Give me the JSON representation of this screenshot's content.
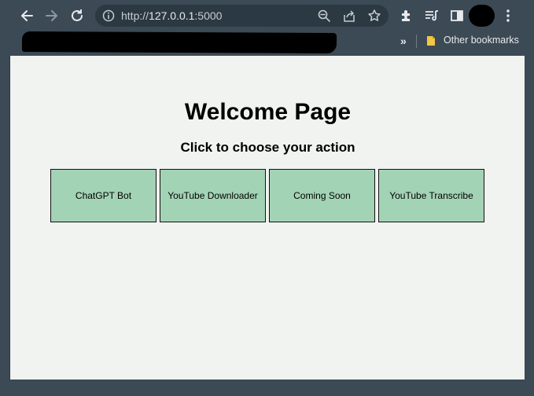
{
  "browser": {
    "url_scheme": "http://",
    "url_host": "127.0.0.1",
    "url_port": ":5000",
    "bookmarks": {
      "overflow": "»",
      "other_bookmarks": "Other bookmarks"
    }
  },
  "page": {
    "title": "Welcome Page",
    "subtitle": "Click to choose your action",
    "actions": [
      {
        "label": "ChatGPT Bot"
      },
      {
        "label": "YouTube Downloader"
      },
      {
        "label": "Coming Soon"
      },
      {
        "label": "YouTube Transcribe"
      }
    ]
  },
  "colors": {
    "button_bg": "#a3d3b5",
    "page_bg": "#f1f3f1",
    "chrome_bg": "#3c4a55"
  }
}
